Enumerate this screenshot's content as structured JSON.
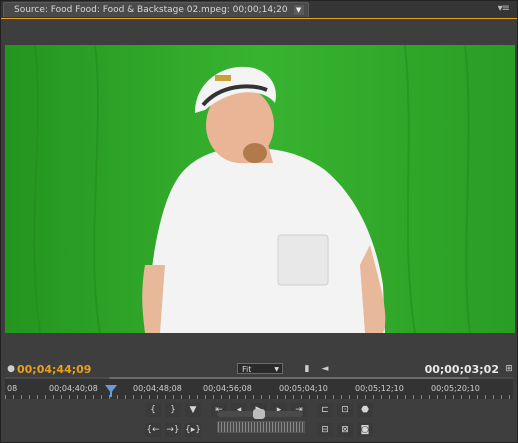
{
  "tab": {
    "title": "Source: Food Food: Food & Backstage 02.mpeg: 00;00;14;20",
    "dropdown_icon": "chevron-down-icon"
  },
  "panel_menu_icon": "panel-menu-icon",
  "viewer": {
    "background_color": "#2fa82b",
    "content": "green-screen-video-frame"
  },
  "timecode": {
    "current": "00;04;44;09",
    "duration": "00;00;03;02",
    "current_color": "#e8a020"
  },
  "zoom": {
    "selected": "Fit"
  },
  "ruler": {
    "labels": [
      "08",
      "00;04;40;08",
      "00;04;48;08",
      "00;04;56;08",
      "00;05;04;10",
      "00;05;12;10",
      "00;05;20;10"
    ]
  },
  "transport": {
    "row1": [
      "mark-in",
      "mark-out",
      "set-marker",
      "goto-in",
      "step-back",
      "play",
      "step-forward",
      "goto-out",
      "insert",
      "overlay",
      "export-frame"
    ],
    "row2": [
      "goto-in-point",
      "goto-out-point",
      "play-in-to-out",
      "lift",
      "extract",
      "camera"
    ]
  }
}
